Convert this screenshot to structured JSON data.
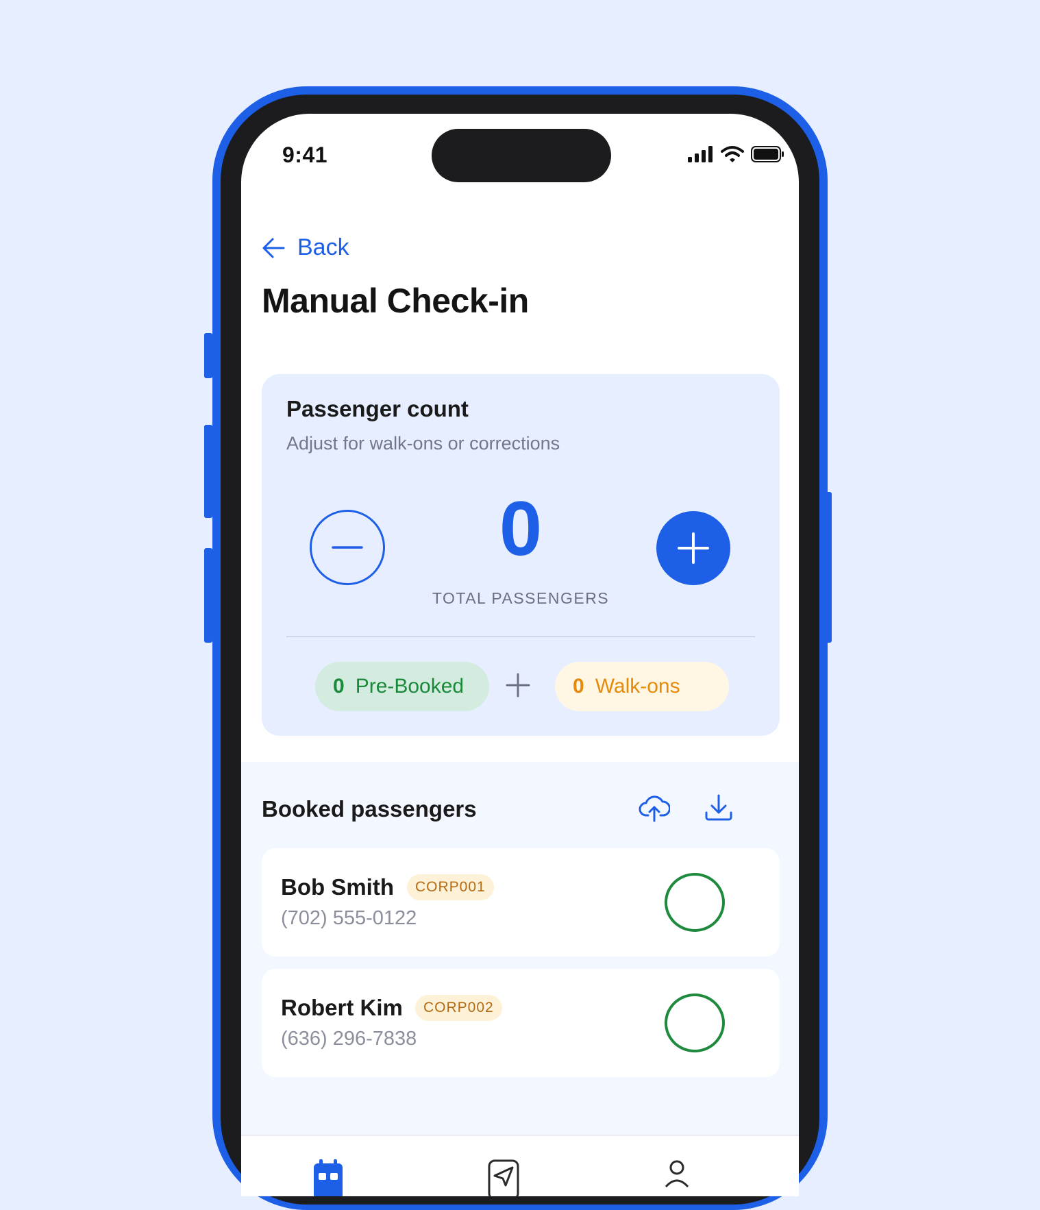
{
  "status_bar": {
    "time": "9:41"
  },
  "nav": {
    "back_label": "Back"
  },
  "page": {
    "title": "Manual Check-in"
  },
  "passenger_count": {
    "title": "Passenger count",
    "subtitle": "Adjust for walk-ons or corrections",
    "total": "0",
    "total_label": "TOTAL PASSENGERS",
    "prebooked_count": "0",
    "prebooked_label": "Pre-Booked",
    "walkons_count": "0",
    "walkons_label": "Walk-ons"
  },
  "booked": {
    "title": "Booked passengers",
    "passengers": [
      {
        "name": "Bob Smith",
        "code": "CORP001",
        "phone": "(702) 555-0122"
      },
      {
        "name": "Robert Kim",
        "code": "CORP002",
        "phone": "(636) 296-7838"
      }
    ]
  },
  "tabs": [
    "calendar-icon",
    "send-icon",
    "profile-icon"
  ],
  "colors": {
    "accent": "#1d5fe6",
    "success": "#1e8a3d",
    "warning": "#e68a0a",
    "background": "#e6eeff"
  }
}
